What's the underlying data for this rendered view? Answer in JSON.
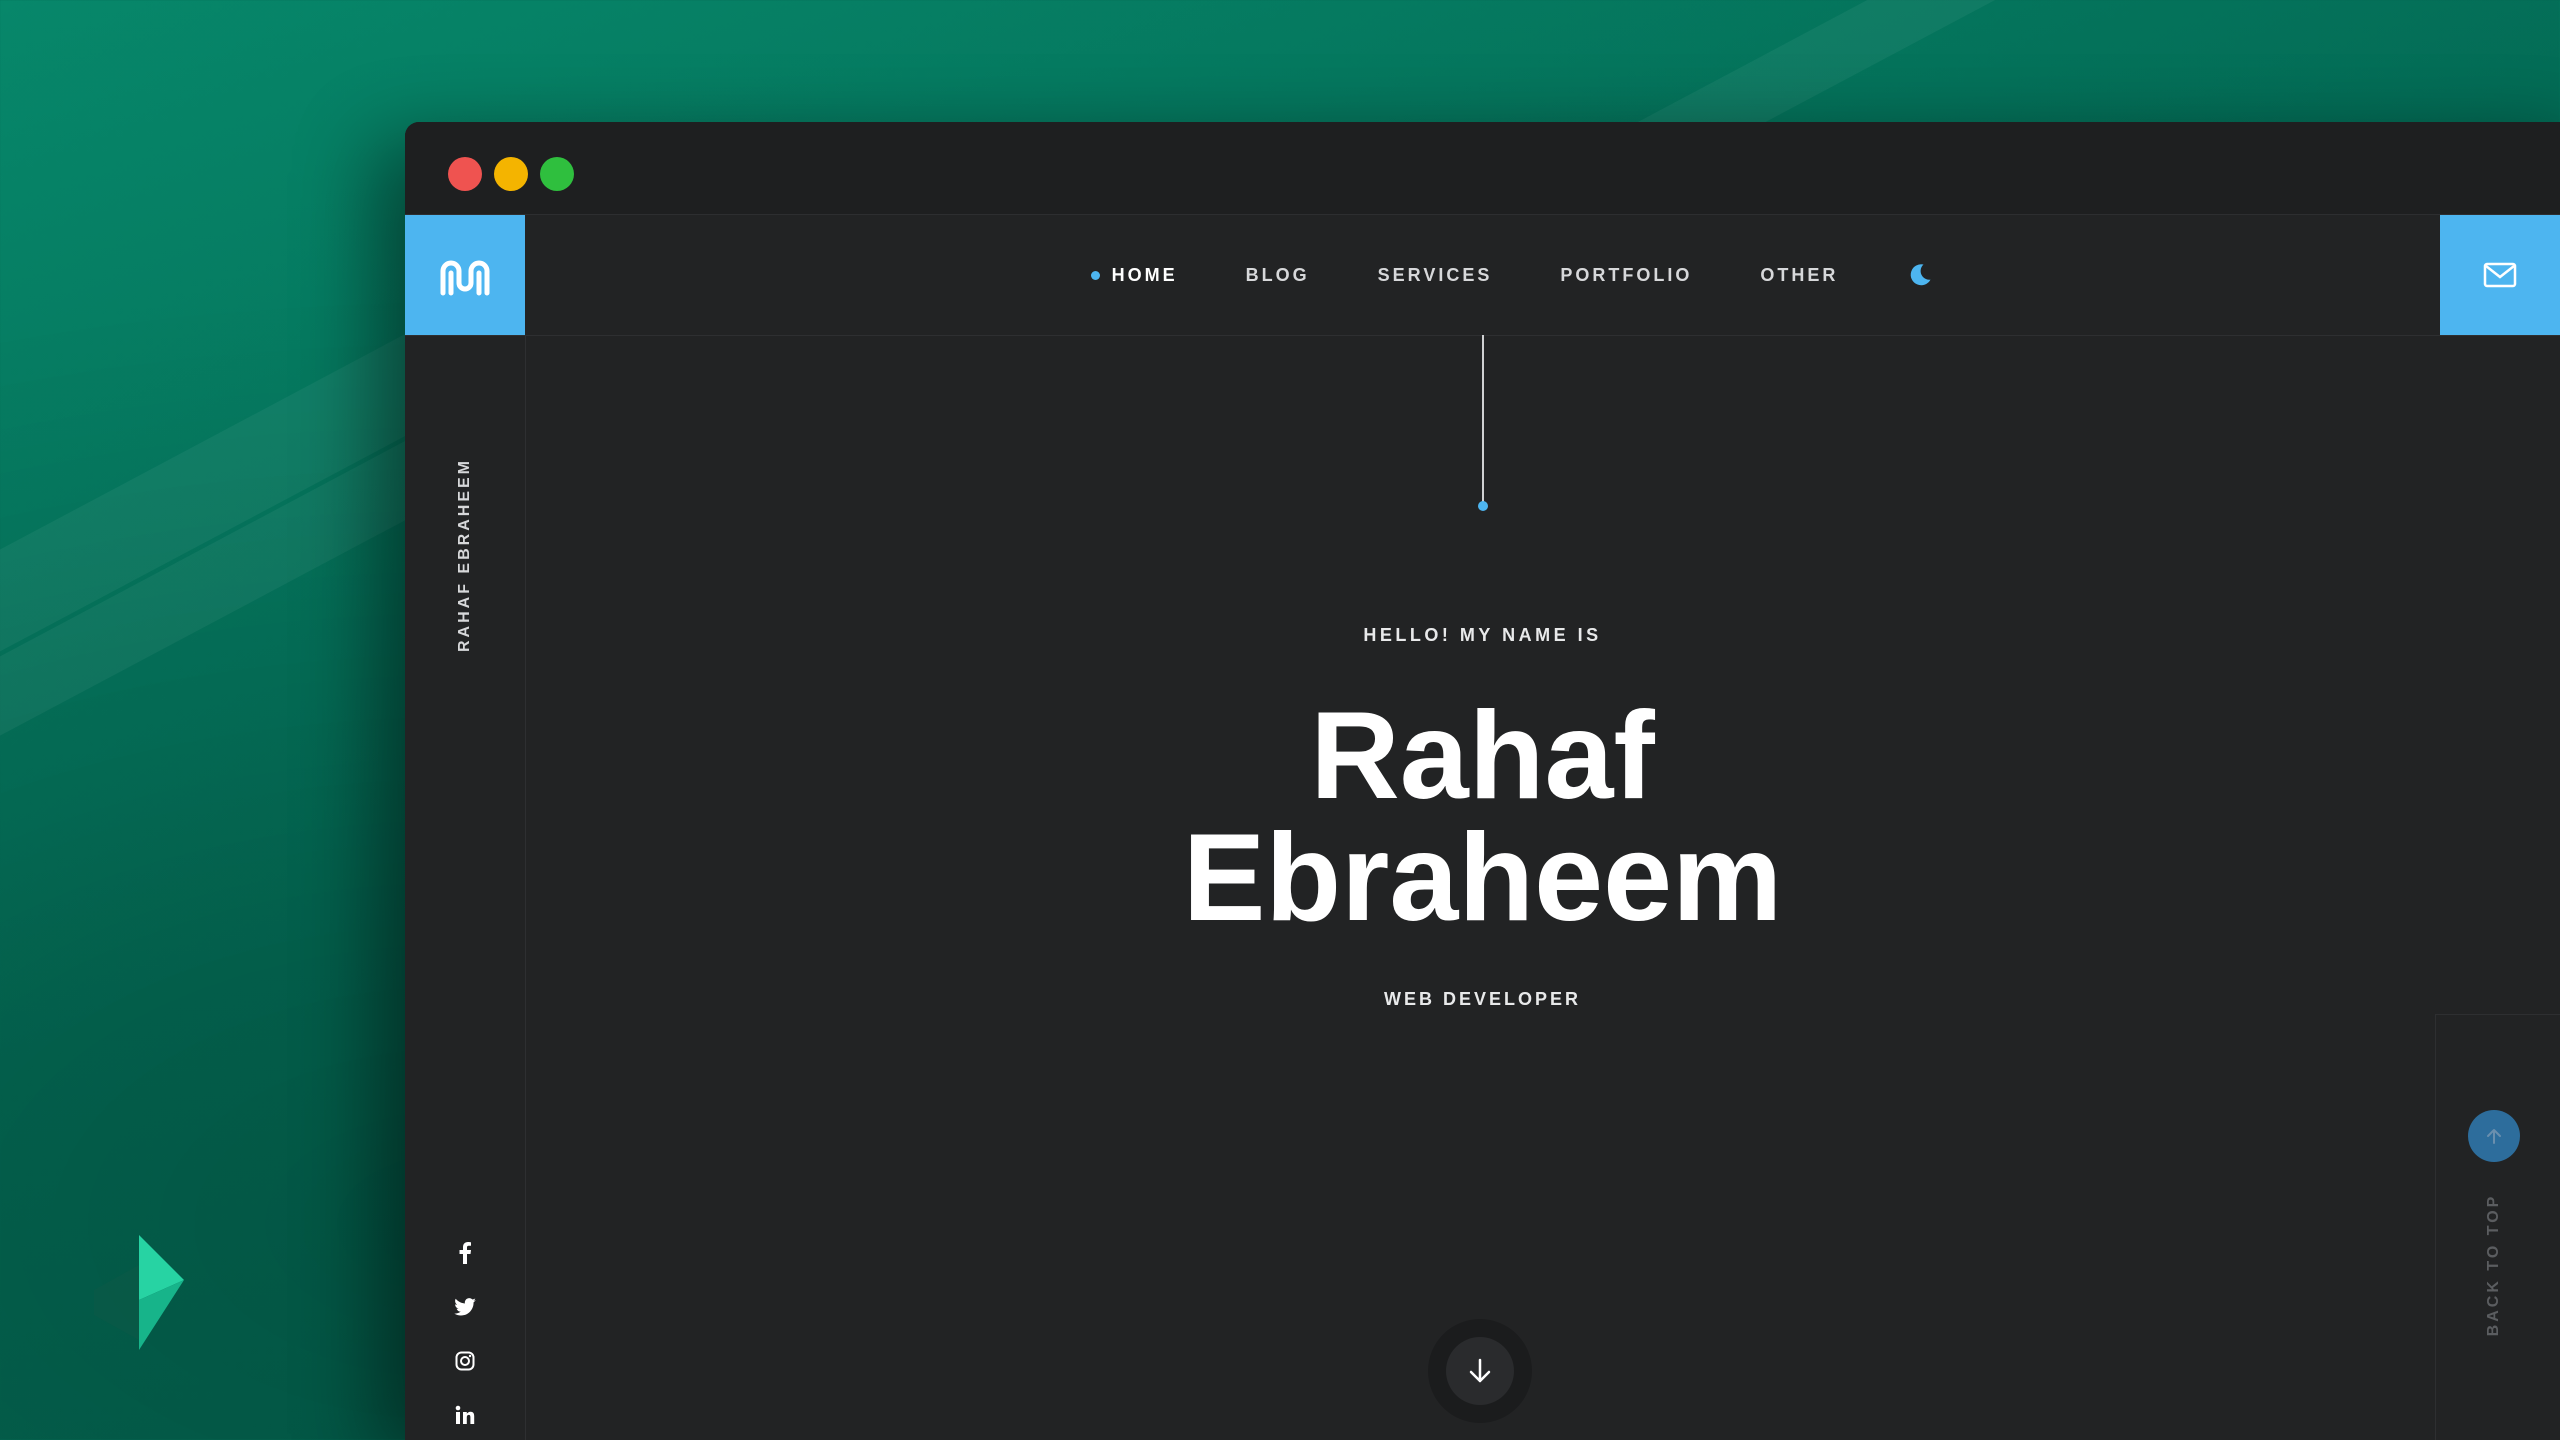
{
  "window": {
    "controls": [
      "close",
      "minimize",
      "maximize"
    ]
  },
  "header": {
    "logo_icon": "brand-logo-icon",
    "nav": [
      {
        "label": "HOME",
        "active": true
      },
      {
        "label": "BLOG",
        "active": false
      },
      {
        "label": "SERVICES",
        "active": false
      },
      {
        "label": "PORTFOLIO",
        "active": false
      },
      {
        "label": "OTHER",
        "active": false
      }
    ],
    "theme_toggle_icon": "moon-icon",
    "contact_icon": "mail-icon"
  },
  "sidebar": {
    "vertical_name": "RAHAF EBRAHEEM",
    "social": [
      "facebook-icon",
      "twitter-icon",
      "instagram-icon",
      "linkedin-icon"
    ]
  },
  "hero": {
    "greeting": "HELLO! MY NAME IS",
    "name_line1": "Rahaf",
    "name_line2": "Ebraheem",
    "role": "WEB DEVELOPER",
    "scroll_icon": "arrow-down-icon"
  },
  "back_to_top": {
    "label": "BACK TO TOP",
    "icon": "arrow-up-icon"
  },
  "colors": {
    "accent": "#4db5f0",
    "background": "#222324",
    "desktop": "#07876a"
  }
}
